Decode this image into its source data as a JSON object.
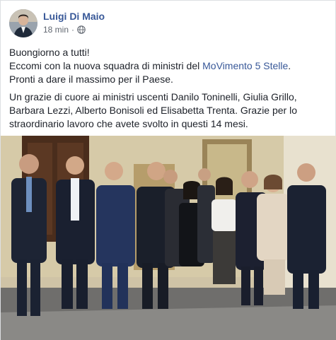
{
  "post": {
    "author": "Luigi Di Maio",
    "time": "18 min",
    "separator": "·",
    "privacy_icon": "globe-icon",
    "text": {
      "line1": "Buongiorno a tutti!",
      "line2_prefix": "Eccomi con la nuova squadra di ministri del ",
      "line2_link": "MoVimento 5 Stelle",
      "line2_suffix": ".",
      "line3": "Pronti a dare il massimo per il Paese.",
      "para2": "Un grazie di cuore ai ministri uscenti Danilo Toninelli, Giulia Grillo, Barbara Lezzi, Alberto Bonisoli ed Elisabetta Trenta. Grazie per lo straordinario lavoro che avete svolto in questi 14 mesi."
    }
  },
  "colors": {
    "link": "#385898",
    "text": "#1d2129",
    "meta": "#616770"
  }
}
